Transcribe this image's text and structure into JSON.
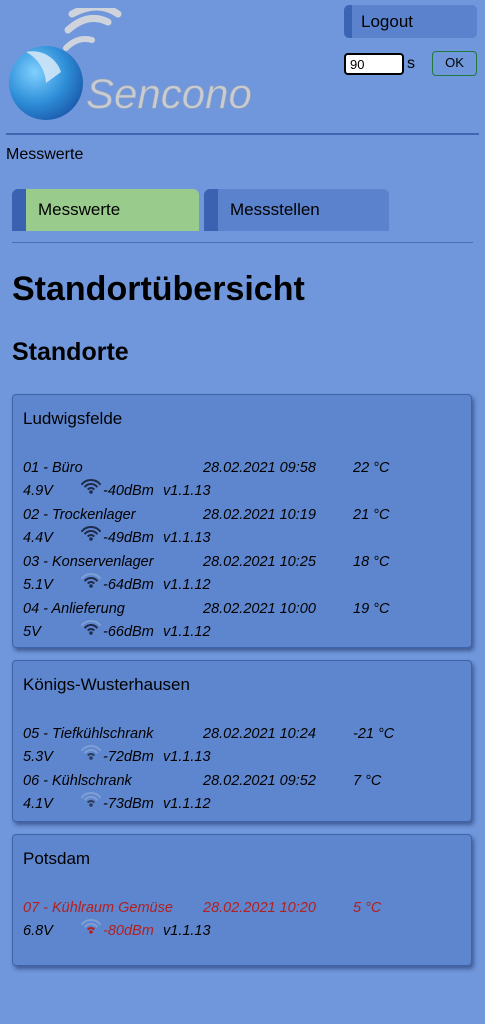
{
  "header": {
    "logo_text": "Sencono",
    "logout_label": "Logout",
    "timeout_value": "90",
    "timeout_unit": "s",
    "ok_label": "OK"
  },
  "breadcrumb": "Messwerte",
  "tabs": [
    {
      "label": "Messwerte",
      "active": true
    },
    {
      "label": "Messstellen",
      "active": false
    }
  ],
  "page_title": "Standortübersicht",
  "section_title": "Standorte",
  "colors": {
    "background": "#7097dc",
    "card": "#5e86ce",
    "active_tab": "#99cb8d",
    "alert": "#b3201f"
  },
  "locations": [
    {
      "name": "Ludwigsfelde",
      "sensors": [
        {
          "name": "01 - Büro",
          "time": "28.02.2021 09:58",
          "temp": "22 °C",
          "voltage": "4.9V",
          "signal": "-40dBm",
          "version": "v1.1.13",
          "wifi_icon": "wifi-strong-icon",
          "alert": false
        },
        {
          "name": "02 - Trockenlager",
          "time": "28.02.2021 10:19",
          "temp": "21 °C",
          "voltage": "4.4V",
          "signal": "-49dBm",
          "version": "v1.1.13",
          "wifi_icon": "wifi-strong-icon",
          "alert": false
        },
        {
          "name": "03 - Konservenlager",
          "time": "28.02.2021 10:25",
          "temp": "18 °C",
          "voltage": "5.1V",
          "signal": "-64dBm",
          "version": "v1.1.12",
          "wifi_icon": "wifi-medium-icon",
          "alert": false
        },
        {
          "name": "04 - Anlieferung",
          "time": "28.02.2021 10:00",
          "temp": "19 °C",
          "voltage": "5V",
          "signal": "-66dBm",
          "version": "v1.1.12",
          "wifi_icon": "wifi-medium-icon",
          "alert": false
        }
      ]
    },
    {
      "name": "Königs-Wusterhausen",
      "sensors": [
        {
          "name": "05 - Tiefkühlschrank",
          "time": "28.02.2021 10:24",
          "temp": "-21 °C",
          "voltage": "5.3V",
          "signal": "-72dBm",
          "version": "v1.1.13",
          "wifi_icon": "wifi-weak-icon",
          "alert": false
        },
        {
          "name": "06 - Kühlschrank",
          "time": "28.02.2021 09:52",
          "temp": "7 °C",
          "voltage": "4.1V",
          "signal": "-73dBm",
          "version": "v1.1.12",
          "wifi_icon": "wifi-weak-icon",
          "alert": false
        }
      ]
    },
    {
      "name": "Potsdam",
      "sensors": [
        {
          "name": "07 - Kühlraum Gemüse",
          "time": "28.02.2021 10:20",
          "temp": "5 °C",
          "voltage": "6.8V",
          "signal": "-80dBm",
          "version": "v1.1.13",
          "wifi_icon": "wifi-alert-icon",
          "alert": true
        }
      ]
    }
  ]
}
